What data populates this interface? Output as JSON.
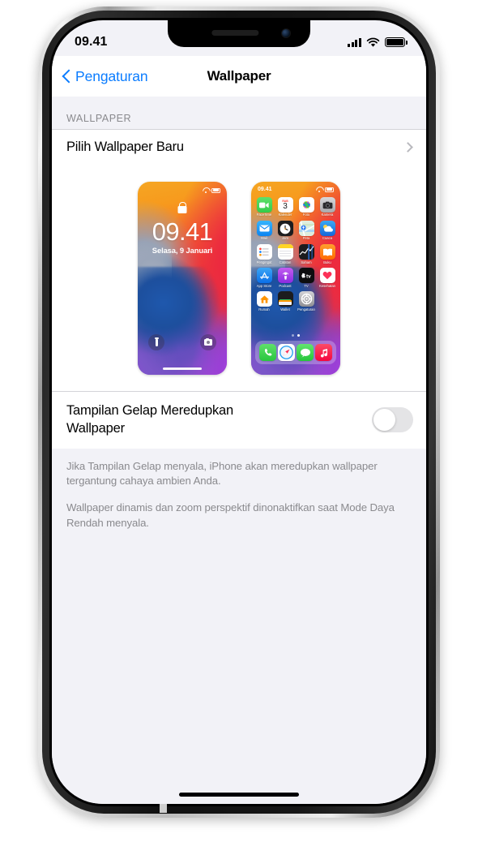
{
  "status_bar": {
    "time": "09.41",
    "icons": [
      "signal-bars-icon",
      "wifi-icon",
      "battery-icon"
    ]
  },
  "nav": {
    "back_label": "Pengaturan",
    "back_icon": "chevron-left-icon",
    "title": "Wallpaper"
  },
  "section": {
    "header": "WALLPAPER"
  },
  "rows": {
    "choose_new": {
      "label": "Pilih Wallpaper Baru",
      "accessory_icon": "chevron-right-icon"
    }
  },
  "lock_preview": {
    "time": "09.41",
    "date": "Selasa, 9 Januari",
    "lock_icon": "lock-icon",
    "left_button_icon": "flashlight-icon",
    "right_button_icon": "camera-icon",
    "status_icons": [
      "wifi-icon",
      "battery-icon"
    ]
  },
  "home_preview": {
    "time": "09.41",
    "status_icons": [
      "wifi-icon",
      "battery-icon"
    ],
    "page_dots": {
      "count": 2,
      "active_index": 1
    },
    "apps": [
      {
        "label": "FaceTime",
        "icon": "facetime-icon"
      },
      {
        "label": "Kalender",
        "icon": "calendar-icon",
        "weekday": "RAB",
        "day": "3"
      },
      {
        "label": "Foto",
        "icon": "photos-icon"
      },
      {
        "label": "Kamera",
        "icon": "camera-app-icon"
      },
      {
        "label": "Mail",
        "icon": "mail-icon"
      },
      {
        "label": "Jam",
        "icon": "clock-icon"
      },
      {
        "label": "Peta",
        "icon": "maps-icon"
      },
      {
        "label": "Cuaca",
        "icon": "weather-icon"
      },
      {
        "label": "Pengingat",
        "icon": "reminders-icon"
      },
      {
        "label": "Catatan",
        "icon": "notes-icon"
      },
      {
        "label": "Saham",
        "icon": "stocks-icon"
      },
      {
        "label": "Buku",
        "icon": "books-icon"
      },
      {
        "label": "App Store",
        "icon": "appstore-icon"
      },
      {
        "label": "Podcast",
        "icon": "podcasts-icon"
      },
      {
        "label": "TV",
        "icon": "tv-icon"
      },
      {
        "label": "Kesehatan",
        "icon": "health-icon"
      },
      {
        "label": "Rumah",
        "icon": "home-icon"
      },
      {
        "label": "Wallet",
        "icon": "wallet-icon"
      },
      {
        "label": "Pengaturan",
        "icon": "settings-icon"
      }
    ],
    "dock": [
      {
        "label": "Telepon",
        "icon": "phone-icon"
      },
      {
        "label": "Safari",
        "icon": "safari-icon"
      },
      {
        "label": "Pesan",
        "icon": "messages-icon"
      },
      {
        "label": "Musik",
        "icon": "music-icon"
      }
    ]
  },
  "toggle": {
    "label": "Tampilan Gelap Meredupkan Wallpaper",
    "state": "off"
  },
  "footer": {
    "paragraph_1": "Jika Tampilan Gelap menyala, iPhone akan meredupkan wallpaper tergantung cahaya ambien Anda.",
    "paragraph_2": "Wallpaper dinamis dan zoom perspektif dinonaktifkan saat Mode Daya Rendah menyala."
  },
  "colors": {
    "accent_blue": "#0a7cff",
    "background": "#f2f2f7",
    "card": "#ffffff",
    "secondary_text": "#8a8a8e",
    "switch_off": "#e4e4e6"
  }
}
